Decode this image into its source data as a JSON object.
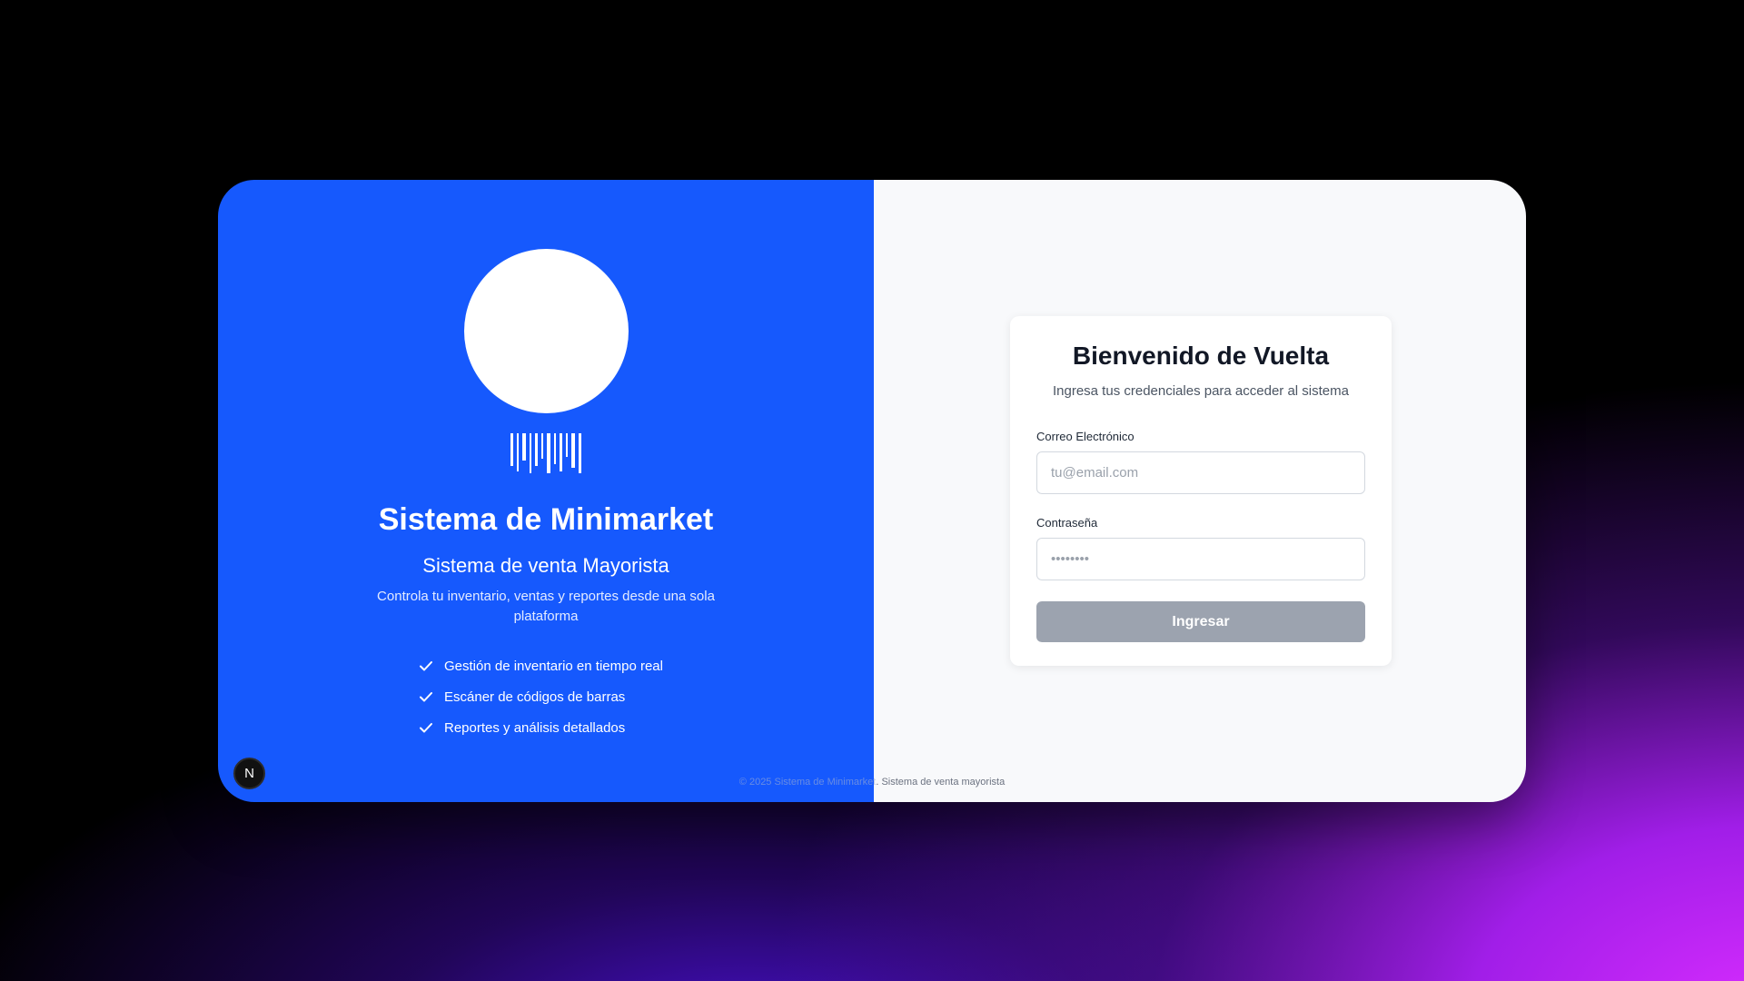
{
  "brand": {
    "title": "Sistema de Minimarket",
    "subtitle": "Sistema de venta Mayorista",
    "description": "Controla tu inventario, ventas y reportes desde una sola plataforma",
    "features": [
      "Gestión de inventario en tiempo real",
      "Escáner de códigos de barras",
      "Reportes y análisis detallados"
    ],
    "accent_color": "#1659fd",
    "logo_icon": "barcode-icon"
  },
  "login": {
    "title": "Bienvenido de Vuelta",
    "subtitle": "Ingresa tus credenciales para acceder al sistema",
    "email_label": "Correo Electrónico",
    "email_placeholder": "tu@email.com",
    "password_label": "Contraseña",
    "password_placeholder": "••••••••",
    "submit_label": "Ingresar",
    "submit_color": "#9ca3af"
  },
  "footer": {
    "text_part1": "© 2025 Sistema de Minimarket",
    "text_part2": ". Sistema de venta mayorista"
  },
  "badge": {
    "letter": "N"
  }
}
